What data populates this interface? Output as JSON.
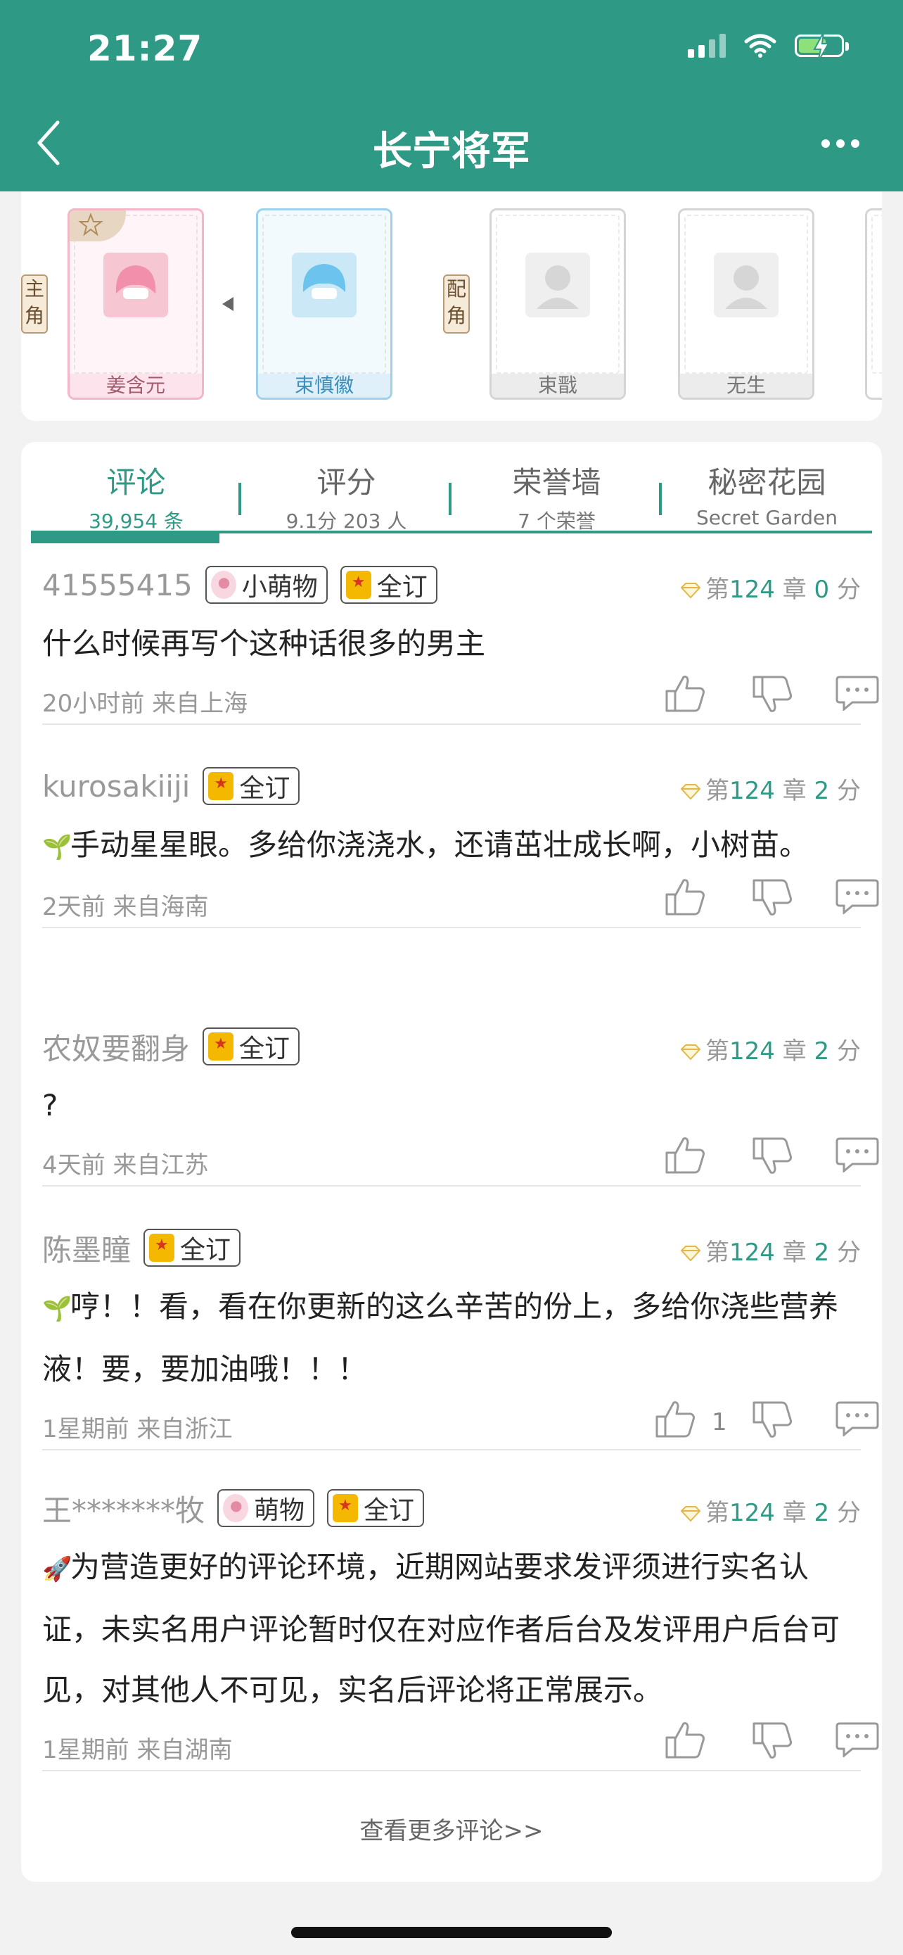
{
  "status_bar": {
    "time": "21:27"
  },
  "header": {
    "title": "长宁将军"
  },
  "roles": {
    "main_tag": "主角",
    "support_tag": "配角",
    "cards": [
      {
        "name": "姜含元",
        "style": "pink"
      },
      {
        "name": "束慎徽",
        "style": "blue"
      },
      {
        "name": "束戬",
        "style": "grey"
      },
      {
        "name": "无生",
        "style": "grey"
      }
    ]
  },
  "tabs": [
    {
      "title": "评论",
      "sub": "39,954 条",
      "active": true
    },
    {
      "title": "评分",
      "sub": "9.1分 203 人",
      "active": false
    },
    {
      "title": "荣誉墙",
      "sub": "7 个荣誉",
      "active": false
    },
    {
      "title": "秘密花园",
      "sub": "Secret Garden",
      "active": false
    }
  ],
  "comments": [
    {
      "user": "41555415",
      "badges": [
        {
          "icon": "paw",
          "label": "小萌物"
        },
        {
          "icon": "book",
          "label": "全订"
        }
      ],
      "meta_prefix": "第",
      "chapter": "124",
      "meta_mid": "章",
      "score": "0",
      "meta_suffix": "分",
      "emoji": "",
      "text": "什么时候再写个这种话很多的男主",
      "time": "20小时前  来自上海",
      "likes": ""
    },
    {
      "user": "kurosakiiji",
      "badges": [
        {
          "icon": "book",
          "label": "全订"
        }
      ],
      "meta_prefix": "第",
      "chapter": "124",
      "meta_mid": "章",
      "score": "2",
      "meta_suffix": "分",
      "emoji": "🌱",
      "text": "手动星星眼。多给你浇浇水，还请茁壮成长啊，小树苗。",
      "time": "2天前  来自海南",
      "likes": ""
    },
    {
      "user": "农奴要翻身",
      "badges": [
        {
          "icon": "book",
          "label": "全订"
        }
      ],
      "meta_prefix": "第",
      "chapter": "124",
      "meta_mid": "章",
      "score": "2",
      "meta_suffix": "分",
      "emoji": "",
      "text": "?",
      "time": "4天前  来自江苏",
      "likes": ""
    },
    {
      "user": "陈墨瞳",
      "badges": [
        {
          "icon": "book",
          "label": "全订"
        }
      ],
      "meta_prefix": "第",
      "chapter": "124",
      "meta_mid": "章",
      "score": "2",
      "meta_suffix": "分",
      "emoji": "🌱",
      "text": "哼！！看，看在你更新的这么辛苦的份上，多给你浇些营养液！要，要加油哦！！！",
      "time": "1星期前  来自浙江",
      "likes": "1"
    },
    {
      "user": "王*******牧",
      "badges": [
        {
          "icon": "paw",
          "label": "萌物"
        },
        {
          "icon": "book",
          "label": "全订"
        }
      ],
      "meta_prefix": "第",
      "chapter": "124",
      "meta_mid": "章",
      "score": "2",
      "meta_suffix": "分",
      "emoji": "🚀",
      "text": "为营造更好的评论环境，近期网站要求发评须进行实名认证，未实名用户评论暂时仅在对应作者后台及发评用户后台可见，对其他人不可见，实名后评论将正常展示。",
      "time": "1星期前  来自湖南",
      "likes": ""
    }
  ],
  "more_comments": "查看更多评论>>"
}
